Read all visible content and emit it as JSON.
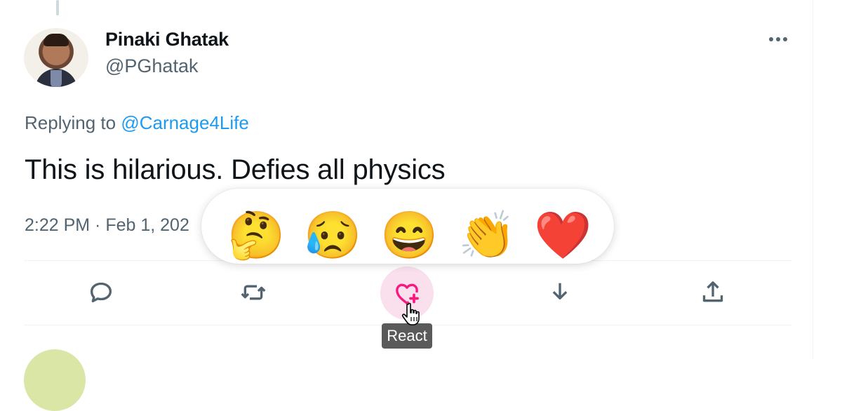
{
  "tweet": {
    "author_name": "Pinaki Ghatak",
    "author_handle": "@PGhatak",
    "replying_prefix": "Replying to",
    "replying_to": "@Carnage4Life",
    "text": "This is hilarious. Defies all physics",
    "timestamp": "2:22 PM · Feb 1, 202"
  },
  "reactions": [
    {
      "name": "thinking-face",
      "glyph": "🤔"
    },
    {
      "name": "sad-tear-face",
      "glyph": "😥"
    },
    {
      "name": "grinning-squinting-face",
      "glyph": "😄"
    },
    {
      "name": "clapping-hands",
      "glyph": "👏"
    },
    {
      "name": "red-heart",
      "glyph": "❤️"
    }
  ],
  "actions": [
    {
      "name": "reply",
      "icon": "reply-icon"
    },
    {
      "name": "retweet",
      "icon": "retweet-icon"
    },
    {
      "name": "react",
      "icon": "heart-plus-icon",
      "active": true
    },
    {
      "name": "save",
      "icon": "download-arrow-icon"
    },
    {
      "name": "share",
      "icon": "share-upload-icon"
    }
  ],
  "tooltip": {
    "label": "React"
  },
  "colors": {
    "accent": "#f91880",
    "link": "#1d9bf0",
    "muted": "#536471",
    "text": "#0f1419"
  }
}
